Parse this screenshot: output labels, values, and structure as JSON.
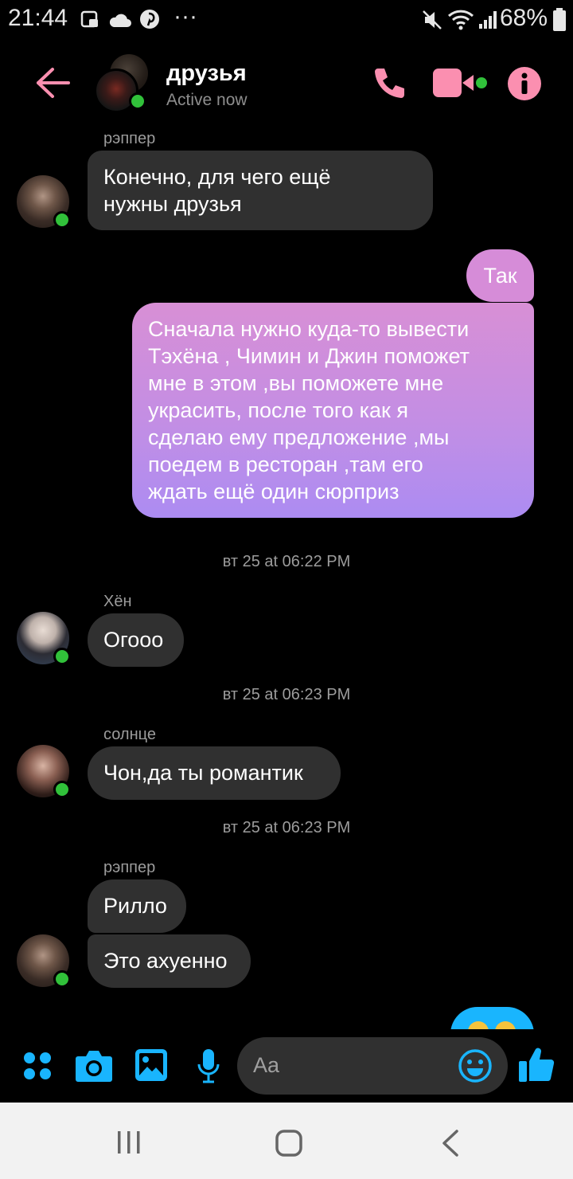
{
  "status_bar": {
    "time": "21:44",
    "battery": "68%",
    "more": "···"
  },
  "header": {
    "title": "друзья",
    "subtitle": "Active now"
  },
  "messages": [
    {
      "sender": "рэппер",
      "lines": [
        "Конечно, для чего ещё",
        "нужны друзья"
      ]
    },
    {
      "out_short": "Так"
    },
    {
      "out_lines": [
        "Сначала нужно куда-то вывести",
        "Тэхёна , Чимин и Джин поможет",
        "мне в этом ,вы поможете мне",
        "украсить, после того как я",
        "сделаю ему предложение ,мы",
        "поедем в ресторан ,там его",
        "ждать ещё один сюрприз"
      ]
    },
    {
      "timestamp": "вт 25 at 06:22 PM"
    },
    {
      "sender": "Хён",
      "text": "Огооо"
    },
    {
      "timestamp": "вт 25 at 06:23 PM"
    },
    {
      "sender": "солнце",
      "text": "Чон,да ты романтик"
    },
    {
      "timestamp": "вт 25 at 06:23 PM"
    },
    {
      "sender": "рэппер",
      "text1": "Рилло",
      "text2": "Это ахуенно"
    }
  ],
  "composer": {
    "placeholder": "Aa"
  },
  "colors": {
    "accent_pink": "#fb8fb0",
    "accent_blue": "#19b5fe",
    "bubble_in": "#303030",
    "bubble_out_top": "#d98fd6",
    "bubble_out_bottom": "#b08cf2",
    "online": "#31c13a"
  }
}
